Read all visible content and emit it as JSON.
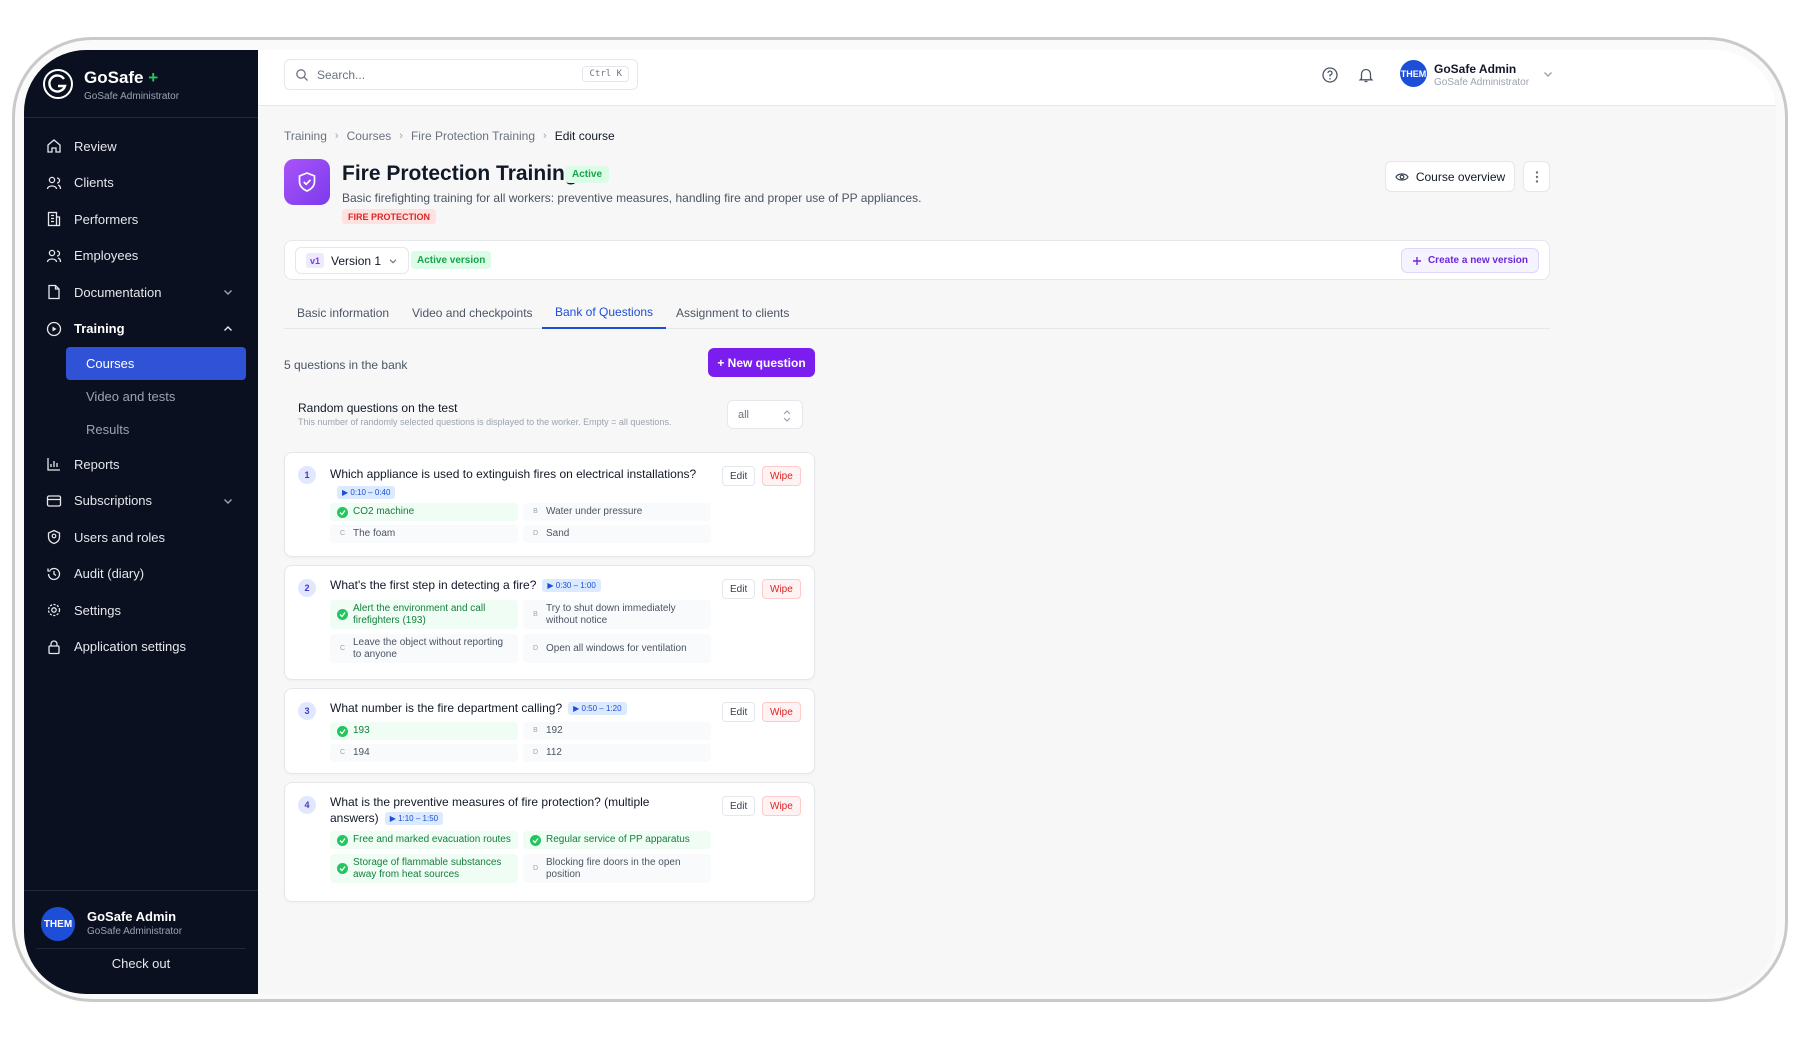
{
  "brand": {
    "name": "GoSafe",
    "plus": "+",
    "subtitle": "GoSafe Administrator"
  },
  "sidebar": {
    "items": [
      {
        "label": "Review",
        "icon": "home-icon"
      },
      {
        "label": "Clients",
        "icon": "users-icon"
      },
      {
        "label": "Performers",
        "icon": "building-icon"
      },
      {
        "label": "Employees",
        "icon": "users-icon"
      },
      {
        "label": "Documentation",
        "icon": "file-icon"
      },
      {
        "label": "Training",
        "icon": "play-circle-icon"
      },
      {
        "label": "Reports",
        "icon": "bar-chart-icon"
      },
      {
        "label": "Subscriptions",
        "icon": "card-icon"
      },
      {
        "label": "Users and roles",
        "icon": "shield-user-icon"
      },
      {
        "label": "Audit (diary)",
        "icon": "history-icon"
      },
      {
        "label": "Settings",
        "icon": "gear-icon"
      },
      {
        "label": "Application settings",
        "icon": "lock-icon"
      }
    ],
    "training_sub": [
      "Courses",
      "Video and tests",
      "Results"
    ],
    "user": {
      "avatar": "THEM",
      "name": "GoSafe Admin",
      "role": "GoSafe Administrator"
    },
    "checkout": "Check out"
  },
  "topbar": {
    "search_placeholder": "Search...",
    "shortcut": "Ctrl K",
    "user": {
      "avatar": "THEM",
      "name": "GoSafe Admin",
      "role": "GoSafe Administrator"
    }
  },
  "breadcrumb": [
    "Training",
    "Courses",
    "Fire Protection Training",
    "Edit course"
  ],
  "course": {
    "title": "Fire Protection Training",
    "status": "Active",
    "description": "Basic firefighting training for all workers: preventive measures, handling fire and proper use of PP appliances.",
    "tag": "FIRE PROTECTION",
    "overview_button": "Course overview"
  },
  "version": {
    "chip": "v1",
    "label": "Version 1",
    "status": "Active version",
    "create_button": "Create a new version"
  },
  "tabs": [
    "Basic information",
    "Video and checkpoints",
    "Bank of Questions",
    "Assignment to clients"
  ],
  "bank": {
    "count_text": "5 questions in the bank",
    "new_button": "+ New question",
    "random_title": "Random questions on the test",
    "random_desc": "This number of randomly selected questions is displayed to the worker. Empty = all questions.",
    "random_value": "all"
  },
  "actions": {
    "edit": "Edit",
    "wipe": "Wipe"
  },
  "questions": [
    {
      "num": "1",
      "text": "Which appliance is used to extinguish fires on electrical installations?",
      "time": "▶ 0:10 – 0:40",
      "answers": [
        {
          "letter": "A",
          "text": "CO2 machine",
          "correct": true
        },
        {
          "letter": "B",
          "text": "Water under pressure",
          "correct": false
        },
        {
          "letter": "C",
          "text": "The foam",
          "correct": false
        },
        {
          "letter": "D",
          "text": "Sand",
          "correct": false
        }
      ]
    },
    {
      "num": "2",
      "text": "What's the first step in detecting a fire?",
      "time": "▶ 0:30 – 1:00",
      "answers": [
        {
          "letter": "A",
          "text": "Alert the environment and call firefighters (193)",
          "correct": true
        },
        {
          "letter": "B",
          "text": "Try to shut down immediately without notice",
          "correct": false
        },
        {
          "letter": "C",
          "text": "Leave the object without reporting to anyone",
          "correct": false
        },
        {
          "letter": "D",
          "text": "Open all windows for ventilation",
          "correct": false
        }
      ]
    },
    {
      "num": "3",
      "text": "What number is the fire department calling?",
      "time": "▶ 0:50 – 1:20",
      "answers": [
        {
          "letter": "A",
          "text": "193",
          "correct": true
        },
        {
          "letter": "B",
          "text": "192",
          "correct": false
        },
        {
          "letter": "C",
          "text": "194",
          "correct": false
        },
        {
          "letter": "D",
          "text": "112",
          "correct": false
        }
      ]
    },
    {
      "num": "4",
      "text": "What is the preventive measures of fire protection? (multiple answers)",
      "time": "▶ 1:10 – 1:50",
      "answers": [
        {
          "letter": "A",
          "text": "Free and marked evacuation routes",
          "correct": true
        },
        {
          "letter": "B",
          "text": "Regular service of PP apparatus",
          "correct": true
        },
        {
          "letter": "C",
          "text": "Storage of flammable substances away from heat sources",
          "correct": true
        },
        {
          "letter": "D",
          "text": "Blocking fire doors in the open position",
          "correct": false
        }
      ]
    }
  ],
  "colors": {
    "sidebar": "#0b1020",
    "accent": "#2f52d6",
    "primary_button": "#7c1df0",
    "success": "#22c55e",
    "danger": "#dc2626"
  }
}
